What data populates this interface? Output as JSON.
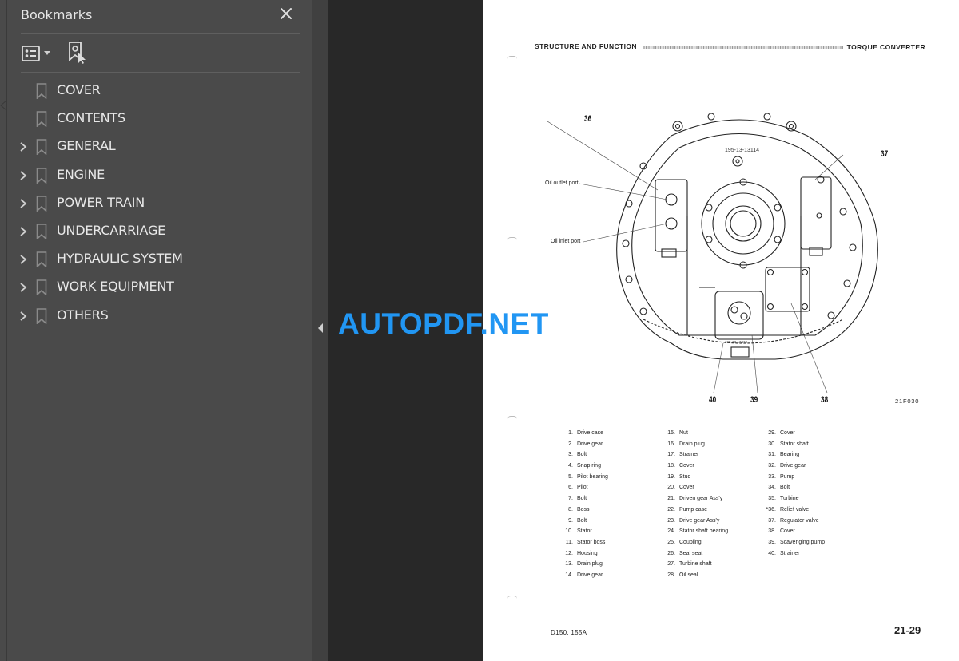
{
  "bookmarks_panel": {
    "title": "Bookmarks",
    "close_icon": "close-icon",
    "toolbar": {
      "options_icon": "list-options-icon",
      "dropdown_icon": "caret-down-icon",
      "find_current_icon": "find-current-bookmark-icon"
    },
    "items": [
      {
        "label": "COVER",
        "expandable": false
      },
      {
        "label": "CONTENTS",
        "expandable": false
      },
      {
        "label": "GENERAL",
        "expandable": true
      },
      {
        "label": "ENGINE",
        "expandable": true
      },
      {
        "label": "POWER TRAIN",
        "expandable": true
      },
      {
        "label": "UNDERCARRIAGE",
        "expandable": true
      },
      {
        "label": "HYDRAULIC SYSTEM",
        "expandable": true
      },
      {
        "label": "WORK EQUIPMENT",
        "expandable": true
      },
      {
        "label": "OTHERS",
        "expandable": true
      }
    ]
  },
  "splitter": {
    "collapse_icon": "collapse-left-arrow-icon"
  },
  "watermark": "AUTOPDF.NET",
  "colors": {
    "panel_bg": "#4a4a4a",
    "canvas_bg": "#282828",
    "watermark": "#2196f3"
  },
  "document_page": {
    "header_left": "STRUCTURE AND FUNCTION",
    "header_right": "TORQUE CONVERTER",
    "drawing": {
      "callouts": [
        "36",
        "37",
        "38",
        "39",
        "40"
      ],
      "part_number_top": "195-13-13114",
      "part_number_pump": "195-13-13410",
      "oil_outlet_label": "Oil outlet port",
      "oil_inlet_label": "Oil inlet port",
      "figure_code": "21F030"
    },
    "legend_columns": [
      [
        {
          "num": "1.",
          "name": "Drive case"
        },
        {
          "num": "2.",
          "name": "Drive gear"
        },
        {
          "num": "3.",
          "name": "Bolt"
        },
        {
          "num": "4.",
          "name": "Snap ring"
        },
        {
          "num": "5.",
          "name": "Pilot bearing"
        },
        {
          "num": "6.",
          "name": "Pilot"
        },
        {
          "num": "7.",
          "name": "Bolt"
        },
        {
          "num": "8.",
          "name": "Boss"
        },
        {
          "num": "9.",
          "name": "Bolt"
        },
        {
          "num": "10.",
          "name": "Stator"
        },
        {
          "num": "11.",
          "name": "Stator boss"
        },
        {
          "num": "12.",
          "name": "Housing"
        },
        {
          "num": "13.",
          "name": "Drain plug"
        },
        {
          "num": "14.",
          "name": "Drive gear"
        }
      ],
      [
        {
          "num": "15.",
          "name": "Nut"
        },
        {
          "num": "16.",
          "name": "Drain plug"
        },
        {
          "num": "17.",
          "name": "Strainer"
        },
        {
          "num": "18.",
          "name": "Cover"
        },
        {
          "num": "19.",
          "name": "Stud"
        },
        {
          "num": "20.",
          "name": "Cover"
        },
        {
          "num": "21.",
          "name": "Driven gear Ass'y"
        },
        {
          "num": "22.",
          "name": "Pump case"
        },
        {
          "num": "23.",
          "name": "Drive gear Ass'y"
        },
        {
          "num": "24.",
          "name": "Stator shaft bearing"
        },
        {
          "num": "25.",
          "name": "Coupling"
        },
        {
          "num": "26.",
          "name": "Seal seat"
        },
        {
          "num": "27.",
          "name": "Turbine shaft"
        },
        {
          "num": "28.",
          "name": "Oil seal"
        }
      ],
      [
        {
          "num": "29.",
          "name": "Cover"
        },
        {
          "num": "30.",
          "name": "Stator shaft"
        },
        {
          "num": "31.",
          "name": "Bearing"
        },
        {
          "num": "32.",
          "name": "Drive gear"
        },
        {
          "num": "33.",
          "name": "Pump"
        },
        {
          "num": "34.",
          "name": "Bolt"
        },
        {
          "num": "35.",
          "name": "Turbine"
        },
        {
          "num": "*36.",
          "name": "Relief valve"
        },
        {
          "num": "37.",
          "name": "Regulator valve"
        },
        {
          "num": "38.",
          "name": "Cover"
        },
        {
          "num": "39.",
          "name": "Scavenging pump"
        },
        {
          "num": "40.",
          "name": "Strainer"
        }
      ]
    ],
    "footer_model": "D150, 155A",
    "page_number": "21-29"
  }
}
